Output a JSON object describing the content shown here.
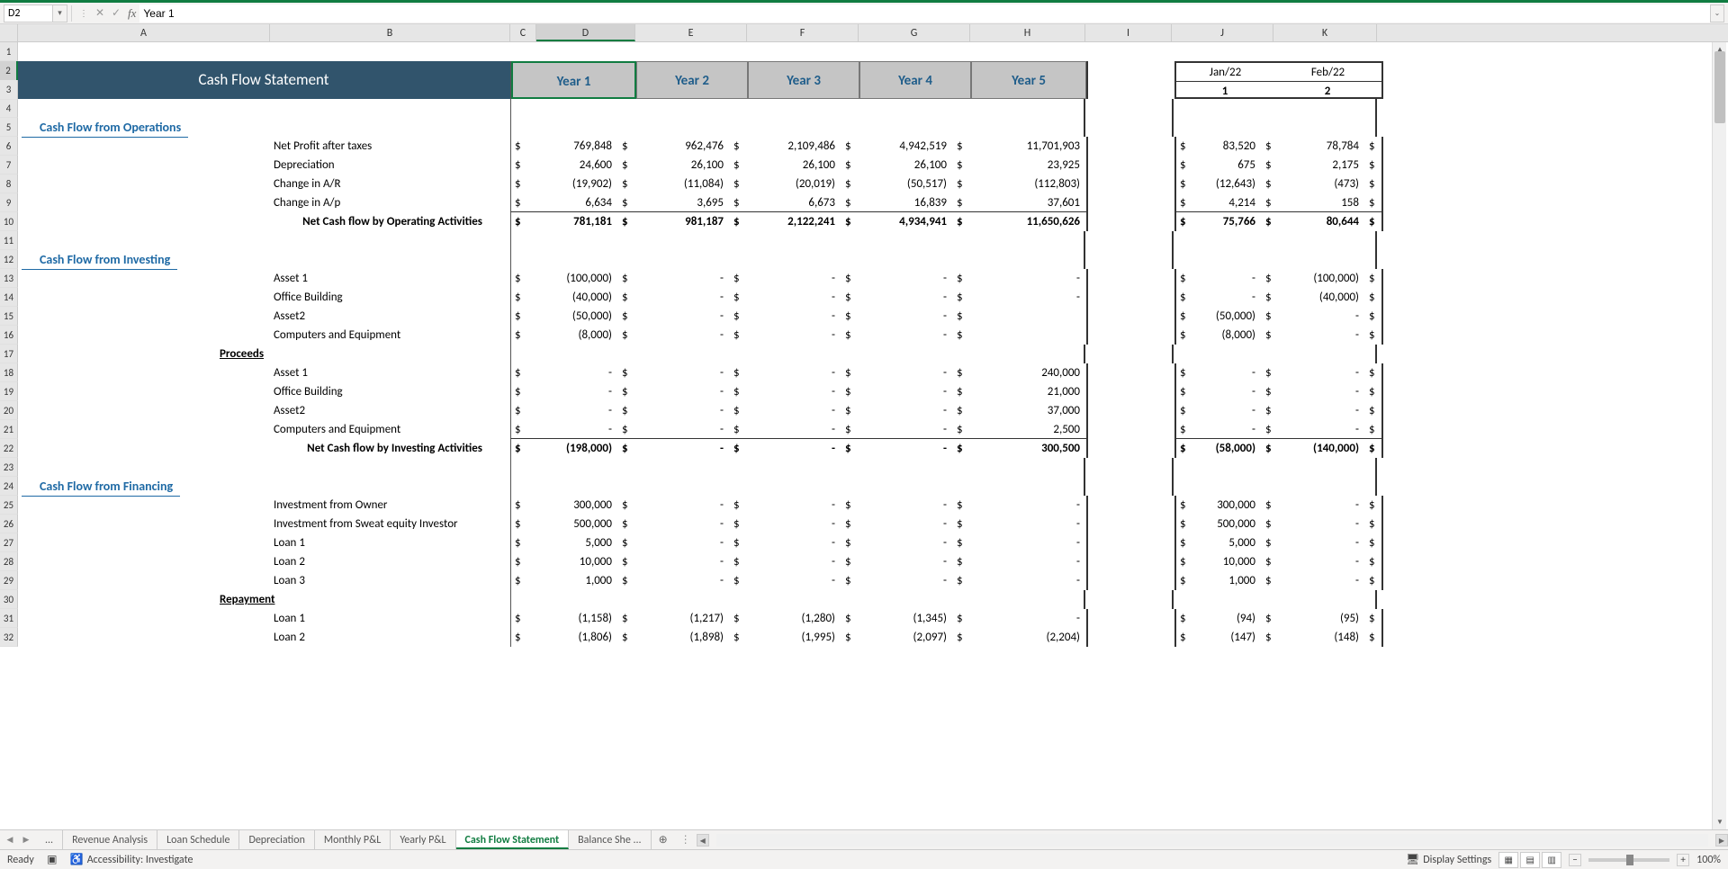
{
  "name_box": "D2",
  "formula_value": "Year 1",
  "columns": [
    "A",
    "B",
    "C",
    "D",
    "E",
    "F",
    "G",
    "H",
    "I",
    "J",
    "K"
  ],
  "selected_column": "D",
  "selected_row": "2",
  "title": "Cash Flow Statement",
  "year_headers": [
    "Year 1",
    "Year 2",
    "Year 3",
    "Year 4",
    "Year 5"
  ],
  "month_headers": [
    "Jan/22",
    "Feb/22"
  ],
  "month_nums": [
    "1",
    "2"
  ],
  "sections": {
    "operations": {
      "title": "Cash Flow from Operations",
      "rows": [
        {
          "label": "Net Profit after taxes",
          "vals": [
            "769,848",
            "962,476",
            "2,109,486",
            "4,942,519",
            "11,701,903"
          ],
          "mvals": [
            "83,520",
            "78,784"
          ]
        },
        {
          "label": "Depreciation",
          "vals": [
            "24,600",
            "26,100",
            "26,100",
            "26,100",
            "23,925"
          ],
          "mvals": [
            "675",
            "2,175"
          ]
        },
        {
          "label": "Change in A/R",
          "vals": [
            "(19,902)",
            "(11,084)",
            "(20,019)",
            "(50,517)",
            "(112,803)"
          ],
          "mvals": [
            "(12,643)",
            "(473)"
          ]
        },
        {
          "label": "Change in A/p",
          "vals": [
            "6,634",
            "3,695",
            "6,673",
            "16,839",
            "37,601"
          ],
          "mvals": [
            "4,214",
            "158"
          ],
          "border": "thin"
        }
      ],
      "total": {
        "label": "Net Cash flow by Operating Activities",
        "vals": [
          "781,181",
          "981,187",
          "2,122,241",
          "4,934,941",
          "11,650,626"
        ],
        "mvals": [
          "75,766",
          "80,644"
        ]
      }
    },
    "investing": {
      "title": "Cash Flow from Investing",
      "rows": [
        {
          "label": "Asset 1",
          "vals": [
            "(100,000)",
            "-",
            "-",
            "-",
            "-"
          ],
          "mvals": [
            "-",
            "(100,000)"
          ]
        },
        {
          "label": "Office Building",
          "vals": [
            "(40,000)",
            "-",
            "-",
            "-",
            "-"
          ],
          "mvals": [
            "-",
            "(40,000)"
          ]
        },
        {
          "label": "Asset2",
          "vals": [
            "(50,000)",
            "-",
            "-",
            "-",
            ""
          ],
          "mvals": [
            "(50,000)",
            "-"
          ]
        },
        {
          "label": "Computers and Equipment",
          "vals": [
            "(8,000)",
            "-",
            "-",
            "-",
            ""
          ],
          "mvals": [
            "(8,000)",
            "-"
          ]
        }
      ],
      "subheader": "Proceeds",
      "proceeds": [
        {
          "label": "Asset 1",
          "vals": [
            "-",
            "-",
            "-",
            "-",
            "240,000"
          ],
          "mvals": [
            "-",
            "-"
          ]
        },
        {
          "label": "Office Building",
          "vals": [
            "-",
            "-",
            "-",
            "-",
            "21,000"
          ],
          "mvals": [
            "-",
            "-"
          ]
        },
        {
          "label": "Asset2",
          "vals": [
            "-",
            "-",
            "-",
            "-",
            "37,000"
          ],
          "mvals": [
            "-",
            "-"
          ]
        },
        {
          "label": "Computers and Equipment",
          "vals": [
            "-",
            "-",
            "-",
            "-",
            "2,500"
          ],
          "mvals": [
            "-",
            "-"
          ],
          "border": "thin"
        }
      ],
      "total": {
        "label": "Net Cash flow by Investing Activities",
        "vals": [
          "(198,000)",
          "-",
          "-",
          "-",
          "300,500"
        ],
        "mvals": [
          "(58,000)",
          "(140,000)"
        ]
      }
    },
    "financing": {
      "title": "Cash Flow from Financing",
      "rows": [
        {
          "label": "Investment from Owner",
          "vals": [
            "300,000",
            "-",
            "-",
            "-",
            "-"
          ],
          "mvals": [
            "300,000",
            "-"
          ]
        },
        {
          "label": "Investment from Sweat equity Investor",
          "vals": [
            "500,000",
            "-",
            "-",
            "-",
            "-"
          ],
          "mvals": [
            "500,000",
            "-"
          ]
        },
        {
          "label": "Loan 1",
          "vals": [
            "5,000",
            "-",
            "-",
            "-",
            "-"
          ],
          "mvals": [
            "5,000",
            "-"
          ]
        },
        {
          "label": "Loan 2",
          "vals": [
            "10,000",
            "-",
            "-",
            "-",
            "-"
          ],
          "mvals": [
            "10,000",
            "-"
          ]
        },
        {
          "label": "Loan 3",
          "vals": [
            "1,000",
            "-",
            "-",
            "-",
            "-"
          ],
          "mvals": [
            "1,000",
            "-"
          ]
        }
      ],
      "subheader": "Repayment",
      "repayment": [
        {
          "label": "Loan 1",
          "vals": [
            "(1,158)",
            "(1,217)",
            "(1,280)",
            "(1,345)",
            "-"
          ],
          "mvals": [
            "(94)",
            "(95)"
          ]
        },
        {
          "label": "Loan 2",
          "vals": [
            "(1,806)",
            "(1,898)",
            "(1,995)",
            "(2,097)",
            "(2,204)"
          ],
          "mvals": [
            "(147)",
            "(148)"
          ],
          "cutoff": true
        }
      ]
    }
  },
  "sheet_tabs": [
    "...",
    "Revenue Analysis",
    "Loan Schedule",
    "Depreciation",
    "Monthly P&L",
    "Yearly P&L",
    "Cash Flow Statement",
    "Balance She ..."
  ],
  "active_tab": "Cash Flow Statement",
  "status": {
    "ready": "Ready",
    "accessibility": "Accessibility: Investigate",
    "display_settings": "Display Settings",
    "zoom": "100%"
  }
}
